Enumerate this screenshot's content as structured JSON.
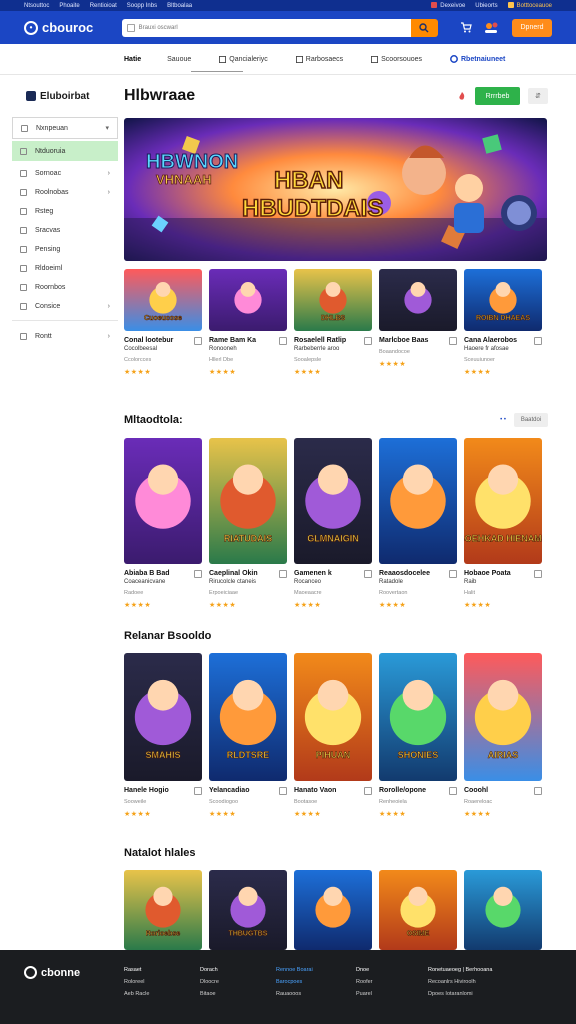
{
  "topstrip": {
    "left": [
      "Ntsouttoc",
      "Phoaite",
      "Rentioioat",
      "Soopp Inbs",
      "Bltboalaa"
    ],
    "right": [
      "Dexeivoe",
      "Ubieorts",
      "Botttoceauoe"
    ]
  },
  "header": {
    "logo": "cbouroc",
    "search_placeholder": "Brauxi oscwarl",
    "cta": "Dpnerd"
  },
  "nav": {
    "items": [
      "Hatie",
      "Sauoue",
      "Qancialeriyc",
      "Rarbosaecs",
      "Scoorsouoes"
    ],
    "highlight": "Rbetnaiuneet"
  },
  "sidebar": {
    "brand": "Eluboirbat",
    "items": [
      {
        "label": "Nxnpeuan",
        "chev": "▾"
      },
      {
        "label": "Ntduoruia",
        "chev": ""
      },
      {
        "label": "Sornoac",
        "chev": "›"
      },
      {
        "label": "Roolnobas",
        "chev": "›"
      },
      {
        "label": "Rsteg",
        "chev": ""
      },
      {
        "label": "Sracvas",
        "chev": ""
      },
      {
        "label": "Pensing",
        "chev": ""
      },
      {
        "label": "Rldoeiml",
        "chev": ""
      },
      {
        "label": "Roornbos",
        "chev": ""
      },
      {
        "label": "Consice",
        "chev": "›"
      },
      {
        "label": "Rontt",
        "chev": "›"
      }
    ]
  },
  "main": {
    "title": "Hlbwraae",
    "filter_btn": "Rrrrbeb",
    "filter_small": "⇵",
    "banner": {
      "badge_line1": "HBWNON",
      "badge_line2": "VHNAAH",
      "title_line1": "HBAN",
      "title_line2": "HBUDTDAIS"
    },
    "section1": [
      {
        "thumb": "Cuoeucose",
        "name": "Conal lootebur",
        "sub": "Cocolbeesal",
        "meta": "Ccolorcces",
        "stars": "★★★★"
      },
      {
        "thumb": "",
        "name": "Rame Bam Ka",
        "sub": "Ronooneh",
        "meta": "Hllerl Dbe",
        "stars": "★★★★"
      },
      {
        "thumb": "DHLBS",
        "name": "Rosaelell Ratlip",
        "sub": "Rarbeberrle aroo",
        "meta": "Sooalepsle",
        "stars": "★★★★"
      },
      {
        "thumb": "",
        "name": "Marlcboe Baas",
        "sub": "",
        "meta": "Boaandocoe",
        "stars": "★★★★"
      },
      {
        "thumb": "ROIBN DHAEAS",
        "name": "Cana Alaerobos",
        "sub": "Haoere fr afosae",
        "meta": "Sceuuiunoer",
        "stars": "★★★★"
      }
    ],
    "section2": {
      "title": "Mltaodtola:",
      "dots": "• •",
      "more": "Baatdoi",
      "cards": [
        {
          "thumb": "",
          "name": "Abiaba B Bad",
          "sub": "Coaceanicvane",
          "meta": "Radoee",
          "stars": "★★★★"
        },
        {
          "thumb": "RIATUDAIS",
          "name": "Caeplinal Okin",
          "sub": "Rirucolcle ctaneis",
          "meta": "Erpoeiciaae",
          "stars": "★★★★"
        },
        {
          "thumb": "GLMNAIGIN",
          "name": "Gamenen k",
          "sub": "Rocanceo",
          "meta": "Maoeaacre",
          "stars": "★★★★"
        },
        {
          "thumb": "",
          "name": "Reaaosdocelee",
          "sub": "Ratadole",
          "meta": "Roovertaon",
          "stars": "★★★★"
        },
        {
          "thumb": "BOEHKAD HIENAMS",
          "name": "Hobaoe Poata",
          "sub": "Raib",
          "meta": "Halit",
          "stars": "★★★★"
        }
      ]
    },
    "section3": {
      "title": "Relanar Bsooldo",
      "cards": [
        {
          "thumb": "SMAHIS",
          "name": "Hanele Hogio",
          "sub": "",
          "meta": "Sooweile",
          "stars": "★★★★"
        },
        {
          "thumb": "RLDTSRE",
          "name": "Yelancadiao",
          "sub": "",
          "meta": "Scoodiogoo",
          "stars": "★★★★"
        },
        {
          "thumb": "PIHUAN",
          "name": "Hanato Vaon",
          "sub": "",
          "meta": "Bootasoe",
          "stars": "★★★★"
        },
        {
          "thumb": "SHONIES",
          "name": "Rorolle/opone",
          "sub": "",
          "meta": "Renheoiela",
          "stars": "★★★★"
        },
        {
          "thumb": "AIRIAS",
          "name": "Cooohl",
          "sub": "",
          "meta": "Roaereloac",
          "stars": "★★★★"
        }
      ]
    },
    "section4": {
      "title": "Natalot hlales",
      "thumbs": [
        "Rorioebse",
        "THBUGTBS",
        "",
        "OSIME",
        ""
      ]
    }
  },
  "footer": {
    "logo": "cbonne",
    "cols": [
      {
        "lines": [
          "Rasaet",
          "Roloreel",
          "",
          "Aeb Racle"
        ]
      },
      {
        "lines": [
          "Dorach",
          "Dloocre",
          "",
          "Bitaoe"
        ]
      },
      {
        "lines": [
          "Rennoe Boarai",
          "Barocpoes",
          "",
          "Rauaooos"
        ]
      },
      {
        "lines": [
          "Dnoe",
          "Roofer",
          "",
          "Puarel"
        ]
      },
      {
        "lines": [
          "Ronetuaeoeg | Berhooana",
          "",
          "Recoanlrs Hiviroolh",
          "Dpoes Iotaranlomi"
        ]
      }
    ]
  },
  "colors": {
    "brand_blue": "#1b46c4",
    "top_strip": "#0f2f8f",
    "accent_orange": "#ff8c1a",
    "green": "#2eb24a",
    "sidebar_active": "#c8efc9",
    "star": "#f5a21a",
    "footer_bg": "#1b1d20"
  }
}
